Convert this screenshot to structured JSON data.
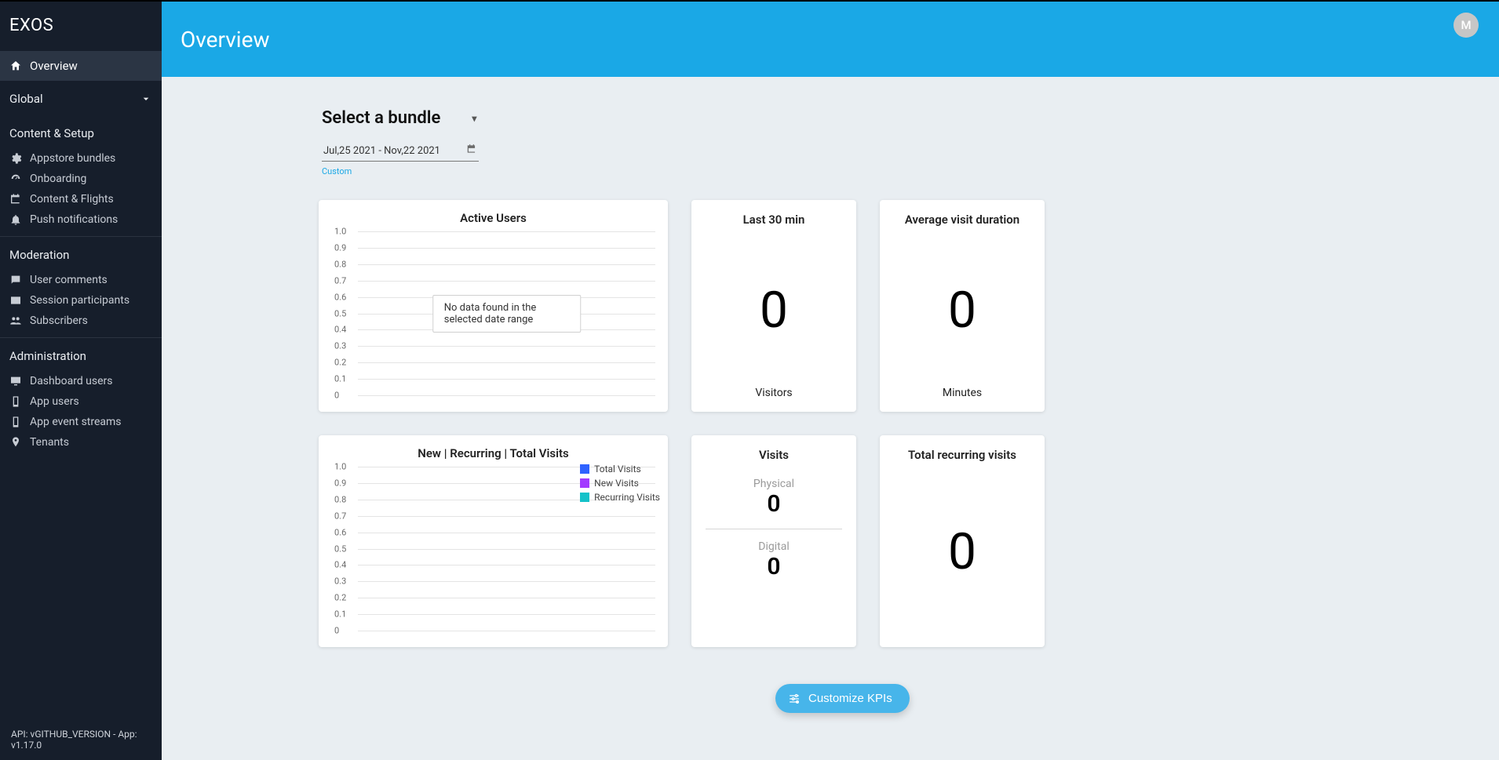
{
  "brand": "EXOS",
  "avatar_initial": "M",
  "sidebar": {
    "overview": "Overview",
    "global": "Global",
    "content_setup_header": "Content & Setup",
    "content_setup": {
      "appstore_bundles": "Appstore bundles",
      "onboarding": "Onboarding",
      "content_flights": "Content & Flights",
      "push_notifications": "Push notifications"
    },
    "moderation_header": "Moderation",
    "moderation": {
      "user_comments": "User comments",
      "session_participants": "Session participants",
      "subscribers": "Subscribers"
    },
    "administration_header": "Administration",
    "administration": {
      "dashboard_users": "Dashboard users",
      "app_users": "App users",
      "app_event_streams": "App event streams",
      "tenants": "Tenants"
    }
  },
  "footer_version": "API: vGITHUB_VERSION - App: v1.17.0",
  "page_title": "Overview",
  "controls": {
    "bundle_label": "Select a bundle",
    "date_range": "Jul,25 2021 - Nov,22 2021",
    "custom_link": "Custom"
  },
  "cards": {
    "active_users": {
      "title": "Active Users",
      "no_data": "No data found in the selected date range"
    },
    "last_30": {
      "title": "Last 30 min",
      "value": "0",
      "sub": "Visitors"
    },
    "avg_visit": {
      "title": "Average visit duration",
      "value": "0",
      "sub": "Minutes"
    },
    "visits_chart": {
      "title": "New | Recurring | Total Visits",
      "legend": {
        "total": "Total Visits",
        "new": "New Visits",
        "recurring": "Recurring Visits"
      },
      "colors": {
        "total": "#2f63ff",
        "new": "#a23bff",
        "recurring": "#15c2c9"
      }
    },
    "visits": {
      "title": "Visits",
      "physical_label": "Physical",
      "physical_value": "0",
      "digital_label": "Digital",
      "digital_value": "0"
    },
    "total_recurring": {
      "title": "Total recurring visits",
      "value": "0"
    }
  },
  "customize_label": "Customize KPIs",
  "chart_data": [
    {
      "type": "line",
      "title": "Active Users",
      "y_ticks": [
        "1.0",
        "0.9",
        "0.8",
        "0.7",
        "0.6",
        "0.5",
        "0.4",
        "0.3",
        "0.2",
        "0.1",
        "0"
      ],
      "no_data_message": "No data found in the selected date range",
      "series": [],
      "ylim": [
        0,
        1.0
      ]
    },
    {
      "type": "line",
      "title": "New | Recurring | Total Visits",
      "y_ticks": [
        "1.0",
        "0.9",
        "0.8",
        "0.7",
        "0.6",
        "0.5",
        "0.4",
        "0.3",
        "0.2",
        "0.1",
        "0"
      ],
      "series": [
        {
          "name": "Total Visits",
          "color": "#2f63ff",
          "values": []
        },
        {
          "name": "New Visits",
          "color": "#a23bff",
          "values": []
        },
        {
          "name": "Recurring Visits",
          "color": "#15c2c9",
          "values": []
        }
      ],
      "ylim": [
        0,
        1.0
      ]
    }
  ]
}
